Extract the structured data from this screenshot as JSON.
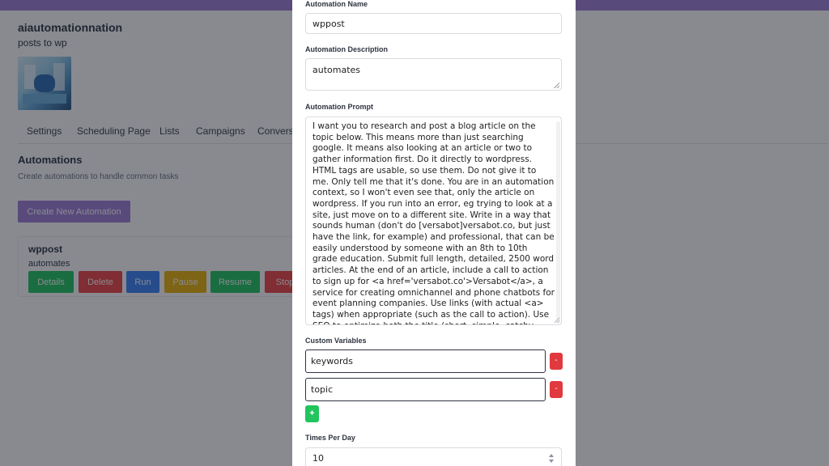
{
  "app": {
    "brand": "aiautomationnation",
    "brand_sub": "posts to wp",
    "logo_icon": "automation-scene-icon",
    "accent": "#a17fd6",
    "tabs": [
      "Settings",
      "Scheduling Page",
      "Lists",
      "Campaigns",
      "Conversa"
    ],
    "section_title": "Automations",
    "section_desc": "Create automations to handle common tasks",
    "create_button": "Create New Automation",
    "automation": {
      "name": "wppost",
      "description": "automates",
      "actions": [
        {
          "label": "Details",
          "color": "#22c55e"
        },
        {
          "label": "Delete",
          "color": "#ef4444"
        },
        {
          "label": "Run",
          "color": "#3b82f6"
        },
        {
          "label": "Pause",
          "color": "#eab308"
        },
        {
          "label": "Resume",
          "color": "#22c55e"
        },
        {
          "label": "Stop",
          "color": "#ef4444"
        }
      ]
    }
  },
  "modal": {
    "name_label": "Automation Name",
    "name_value": "wppost",
    "description_label": "Automation Description",
    "description_value": "automates",
    "prompt_label": "Automation Prompt",
    "prompt_value": "I want you to research and post a blog article on the topic below. This means more than just searching google. It means also looking at an article or two to gather information first. Do it directly to wordpress. HTML tags are usable, so use them. Do not give it to me. Only tell me that it's done. You are in an automation context, so I won't even see that, only the article on wordpress. If you run into an error, eg trying to look at a site, just move on to a different site. Write in a way that sounds human (don't do [versabot]versabot.co, but just have the link, for example) and professional, that can be easily understood by someone with an 8th to 10th grade education. Submit full length, detailed, 2500 word articles. At the end of an article, include a call to action to sign up for <a href='versabot.co'>Versabot</a>, a service for creating omnichannel and phone chatbots for event planning companies. Use links (with actual <a> tags) when appropriate (such as the call to action). Use SEO to optimize both the title (short, simple, catchy title, and written",
    "custom_vars_label": "Custom Variables",
    "variables": [
      "keywords",
      "topic"
    ],
    "remove_label": "-",
    "add_label": "+",
    "times_label": "Times Per Day",
    "times_value": "10"
  }
}
